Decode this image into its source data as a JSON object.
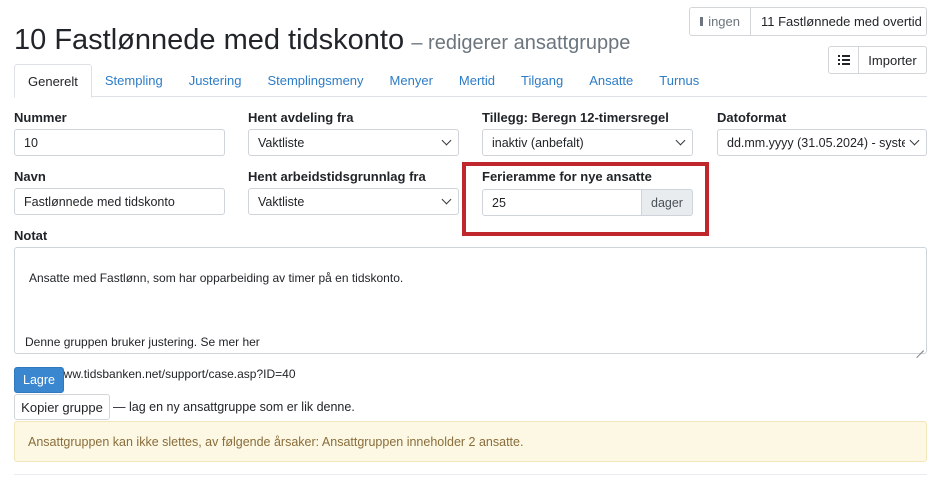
{
  "header": {
    "title": "10 Fastlønnede med tidskonto",
    "subtitle": "– redigerer ansattgruppe"
  },
  "top_nav": {
    "prev_label": "ingen",
    "next_label": "11 Fastlønnede med overtid",
    "importer_label": "Importer"
  },
  "tabs": [
    {
      "label": "Generelt",
      "active": true
    },
    {
      "label": "Stempling"
    },
    {
      "label": "Justering"
    },
    {
      "label": "Stemplingsmeny"
    },
    {
      "label": "Menyer"
    },
    {
      "label": "Mertid"
    },
    {
      "label": "Tilgang"
    },
    {
      "label": "Ansatte"
    },
    {
      "label": "Turnus"
    }
  ],
  "form": {
    "nummer": {
      "label": "Nummer",
      "value": "10"
    },
    "avdeling": {
      "label": "Hent avdeling fra",
      "value": "Vaktliste"
    },
    "tillegg": {
      "label": "Tillegg: Beregn 12-timersregel",
      "value": "inaktiv (anbefalt)"
    },
    "datoformat": {
      "label": "Datoformat",
      "value": "dd.mm.yyyy (31.05.2024) - system"
    },
    "navn": {
      "label": "Navn",
      "value": "Fastlønnede med tidskonto"
    },
    "arbeidstid": {
      "label": "Hent arbeidstidsgrunnlag fra",
      "value": "Vaktliste"
    },
    "ferieramme": {
      "label": "Ferieramme for nye ansatte",
      "value": "25",
      "unit": "dager"
    },
    "notat": {
      "label": "Notat",
      "line1": "Ansatte med Fastlønn, som har opparbeiding av timer på en tidskonto.",
      "line2": "Denne gruppen bruker justering. Se mer her",
      "line3": "http://www.tidsbanken.net/support/case.asp?ID=40"
    }
  },
  "actions": {
    "save_label": "Lagre",
    "copy_label": "Kopier gruppe",
    "copy_hint": "— lag en ny ansattgruppe som er lik denne."
  },
  "alert": {
    "text": "Ansattgruppen kan ikke slettes, av følgende årsaker: Ansattgruppen inneholder 2 ansatte."
  },
  "colors": {
    "accent": "#3a87d0",
    "link": "#2d7cc6",
    "highlight": "#c0272d",
    "warning_bg": "#fcf8e3"
  }
}
